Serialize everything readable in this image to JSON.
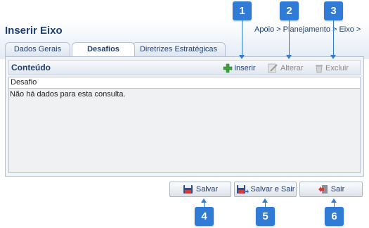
{
  "page": {
    "title": "Inserir Eixo",
    "breadcrumb": "Apoio > Planejamento > Eixo >"
  },
  "tabs": [
    {
      "label": "Dados Gerais",
      "active": false
    },
    {
      "label": "Desafios",
      "active": true
    },
    {
      "label": "Diretrizes Estratégicas",
      "active": false
    }
  ],
  "panel": {
    "title": "Conteúdo",
    "toolbar": {
      "insert": {
        "label": "Inserir",
        "icon": "plus-icon",
        "enabled": true
      },
      "alter": {
        "label": "Alterar",
        "icon": "edit-icon",
        "enabled": false
      },
      "delete": {
        "label": "Excluir",
        "icon": "trash-icon",
        "enabled": false
      }
    },
    "grid": {
      "columns": [
        "Desafio"
      ],
      "empty_message": "Não há dados para esta consulta."
    }
  },
  "footer": {
    "save": {
      "label": "Salvar",
      "icon": "floppy-disk-icon"
    },
    "save_and_quit": {
      "label": "Salvar e Sair",
      "icon": "floppy-disk-arrow-icon"
    },
    "quit": {
      "label": "Sair",
      "icon": "exit-door-icon"
    }
  },
  "callouts": [
    "1",
    "2",
    "3",
    "4",
    "5",
    "6"
  ],
  "colors": {
    "accent": "#2f7bd6",
    "title": "#1f3f6e",
    "insert_green": "#3aa53a"
  }
}
